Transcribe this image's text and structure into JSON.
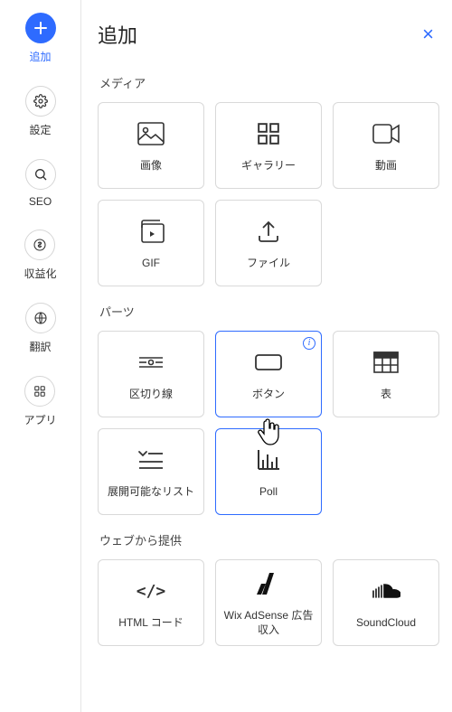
{
  "sidebar": {
    "items": [
      {
        "label": "追加",
        "icon": "plus-icon",
        "active": true,
        "primary": true
      },
      {
        "label": "設定",
        "icon": "gear-icon",
        "active": false,
        "primary": false
      },
      {
        "label": "SEO",
        "icon": "search-icon",
        "active": false,
        "primary": false
      },
      {
        "label": "収益化",
        "icon": "dollar-icon",
        "active": false,
        "primary": false
      },
      {
        "label": "翻訳",
        "icon": "globe-icon",
        "active": false,
        "primary": false
      },
      {
        "label": "アプリ",
        "icon": "grid4-icon",
        "active": false,
        "primary": false
      }
    ]
  },
  "panel": {
    "title": "追加",
    "close_label": "×"
  },
  "sections": [
    {
      "title": "メディア",
      "items": [
        {
          "label": "画像",
          "icon": "image-icon"
        },
        {
          "label": "ギャラリー",
          "icon": "grid4-icon"
        },
        {
          "label": "動画",
          "icon": "video-icon"
        },
        {
          "label": "GIF",
          "icon": "gif-icon"
        },
        {
          "label": "ファイル",
          "icon": "upload-icon"
        }
      ]
    },
    {
      "title": "パーツ",
      "items": [
        {
          "label": "区切り線",
          "icon": "divider-icon"
        },
        {
          "label": "ボタン",
          "icon": "button-icon",
          "selected": true,
          "info": true
        },
        {
          "label": "表",
          "icon": "table-icon"
        },
        {
          "label": "展開可能なリスト",
          "icon": "collapse-list-icon"
        },
        {
          "label": "Poll",
          "icon": "poll-icon",
          "box_outline": true
        }
      ]
    },
    {
      "title": "ウェブから提供",
      "items": [
        {
          "label": "HTML コード",
          "icon": "code-icon"
        },
        {
          "label": "Wix AdSense 広告収入",
          "icon": "adsense-icon"
        },
        {
          "label": "SoundCloud",
          "icon": "soundcloud-icon"
        }
      ]
    }
  ]
}
